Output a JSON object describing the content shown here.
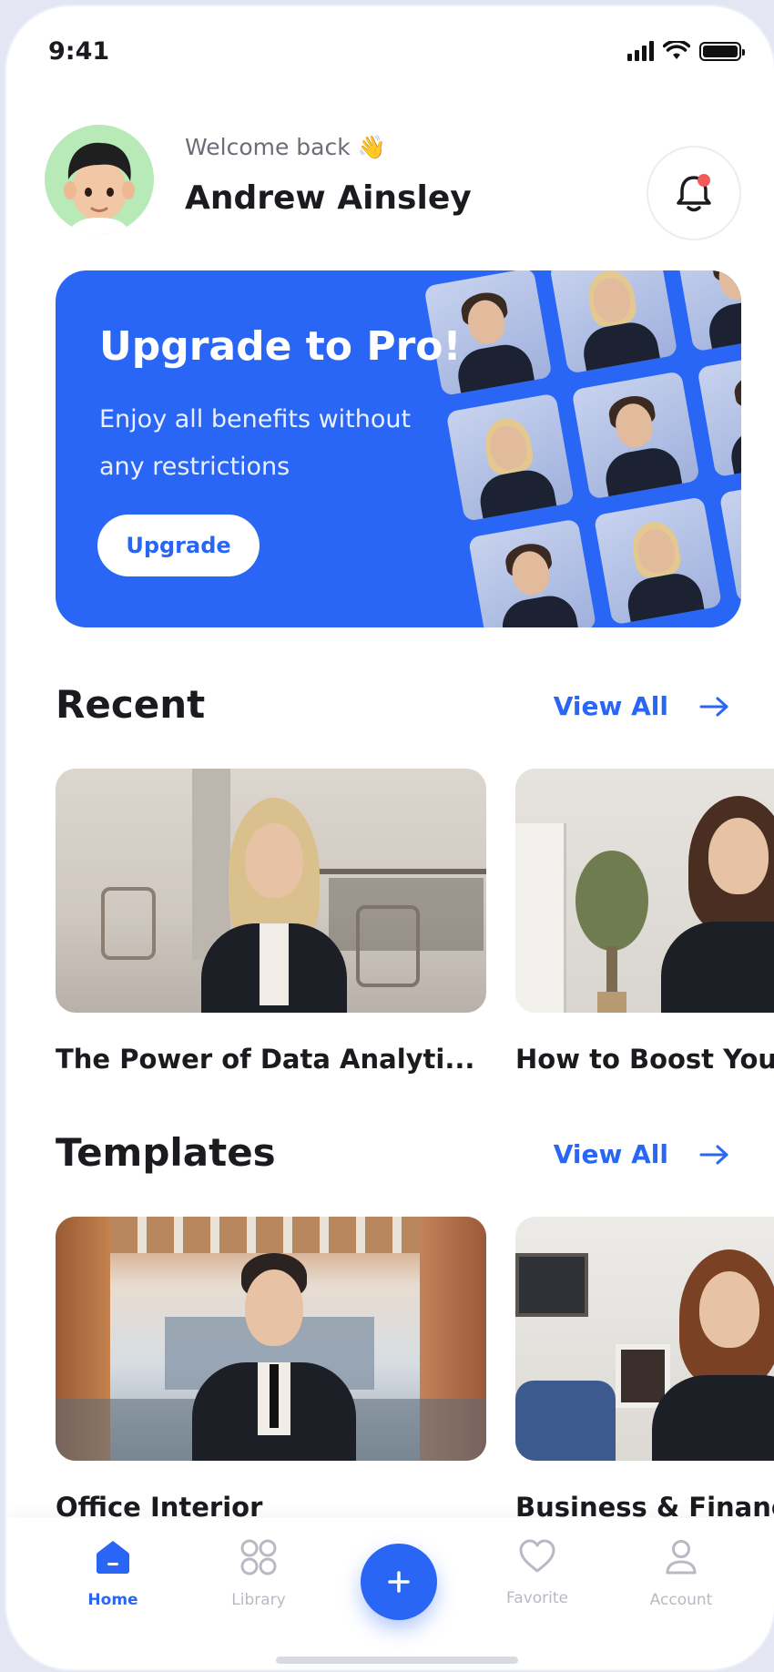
{
  "status_bar": {
    "time": "9:41"
  },
  "header": {
    "welcome": "Welcome back 👋",
    "username": "Andrew Ainsley"
  },
  "banner": {
    "title": "Upgrade to Pro!",
    "subtitle": "Enjoy all benefits without any restrictions",
    "button_label": "Upgrade"
  },
  "recent": {
    "title": "Recent",
    "view_all": "View All",
    "items": [
      {
        "title": "The Power of Data Analyti..."
      },
      {
        "title": "How to Boost Your"
      }
    ]
  },
  "templates": {
    "title": "Templates",
    "view_all": "View All",
    "items": [
      {
        "title": "Office Interior"
      },
      {
        "title": "Business & Finance"
      }
    ]
  },
  "bottom_nav": {
    "items": [
      {
        "label": "Home",
        "icon": "home-icon",
        "active": true
      },
      {
        "label": "Library",
        "icon": "grid-icon",
        "active": false
      },
      {
        "label": "Favorite",
        "icon": "heart-icon",
        "active": false
      },
      {
        "label": "Account",
        "icon": "user-icon",
        "active": false
      }
    ],
    "fab_icon": "plus-icon"
  },
  "colors": {
    "accent": "#2966f5",
    "text": "#1b1b1f",
    "muted": "#b9b9c4",
    "avatar_bg": "#b7eab7"
  }
}
